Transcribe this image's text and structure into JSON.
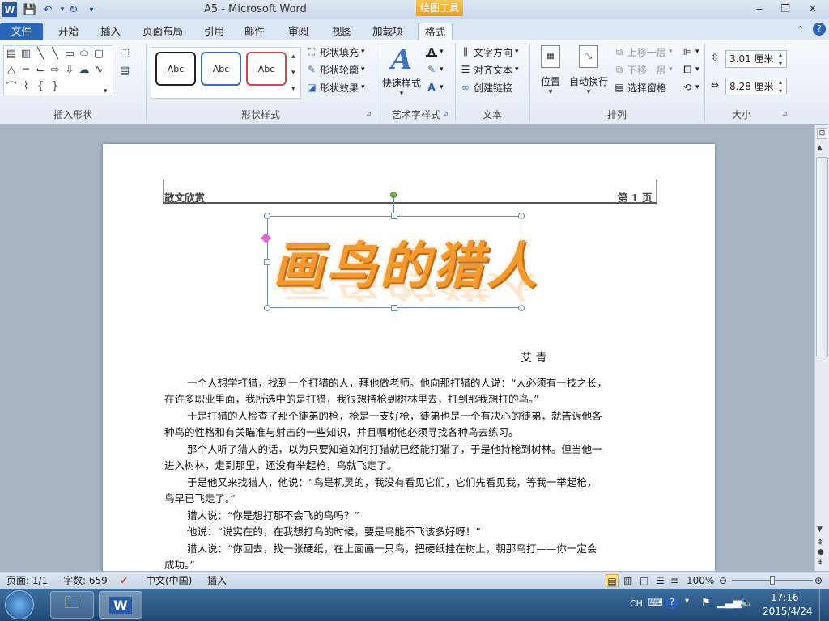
{
  "window": {
    "title": "A5 - Microsoft Word",
    "contextual_tab_group": "绘图工具"
  },
  "tabs": [
    "文件",
    "开始",
    "插入",
    "页面布局",
    "引用",
    "邮件",
    "审阅",
    "视图",
    "加载项",
    "格式"
  ],
  "ribbon": {
    "groups": {
      "insert_shapes": "插入形状",
      "shape_styles": "形状样式",
      "wordart_styles": "艺术字样式",
      "text": "文本",
      "arrange": "排列",
      "size": "大小"
    },
    "shape_styles": {
      "fill": "形状填充",
      "outline": "形状轮廓",
      "effect": "形状效果",
      "samples": [
        "Abc",
        "Abc",
        "Abc"
      ]
    },
    "wordart": {
      "quick_styles": "快速样式"
    },
    "text_group": {
      "direction": "文字方向",
      "align": "对齐文本",
      "link": "创建链接"
    },
    "arrange": {
      "position": "位置",
      "wrap": "自动换行",
      "bring_forward": "上移一层",
      "send_backward": "下移一层",
      "selection_pane": "选择窗格"
    },
    "size": {
      "height": "3.01 厘米",
      "width": "8.28 厘米"
    }
  },
  "document": {
    "header_left": "散文欣赏",
    "header_right": "第 1 页",
    "wordart_title": "画鸟的猎人",
    "author": "艾 青",
    "paragraphs": [
      "一个人想学打猎，找到一个打猎的人，拜他做老师。他向那打猎的人说：“人必须有一技之长，",
      "在许多职业里面，我所选中的是打猎，我很想持枪到树林里去，打到那我想打的鸟。”",
      "于是打猎的人检查了那个徒弟的枪，枪是一支好枪，徒弟也是一个有决心的徒弟，就告诉他各",
      "种鸟的性格和有关瞄准与射击的一些知识，并且嘱咐他必须寻找各种鸟去练习。",
      "那个人听了猎人的话，以为只要知道如何打猎就已经能打猎了，于是他持枪到树林。但当他一",
      "进入树林，走到那里，还没有举起枪，鸟就飞走了。",
      "于是他又来找猎人，他说：“鸟是机灵的，我没有看见它们，它们先看见我，等我一举起枪，",
      "鸟早已飞走了。”",
      "猎人说：“你是想打那不会飞的鸟吗？”",
      "他说：“说实在的，在我想打鸟的时候，要是鸟能不飞该多好呀！”",
      "猎人说：“你回去，找一张硬纸，在上面画一只鸟，把硬纸挂在树上，朝那鸟打——你一定会",
      "成功。”"
    ]
  },
  "status": {
    "page": "页面: 1/1",
    "words": "字数: 659",
    "language": "中文(中国)",
    "mode": "插入",
    "zoom": "100%",
    "zoom_level": 100
  },
  "taskbar": {
    "lang": "CH",
    "time": "17:16",
    "date": "2015/4/24"
  },
  "colors": {
    "file_tab": "#2a66b8",
    "wordart_fill": "#f39a2e",
    "drawtools": "#e9a020"
  }
}
